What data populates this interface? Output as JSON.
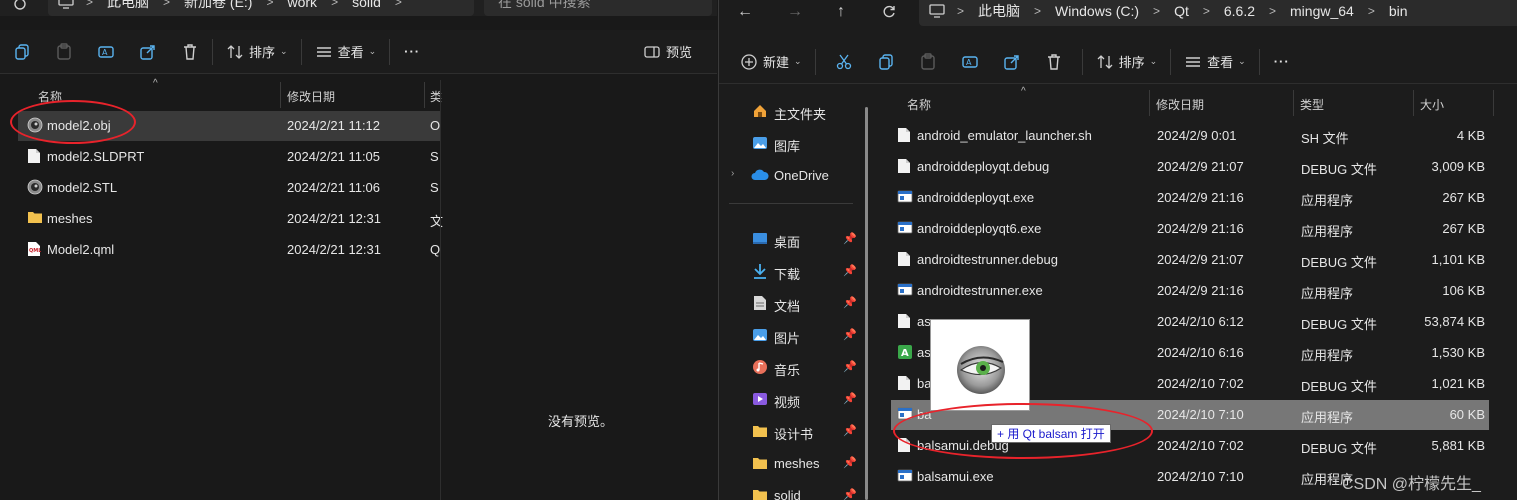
{
  "left_window": {
    "breadcrumb": [
      "此电脑",
      "新加卷 (E:)",
      "work",
      "solid"
    ],
    "search_placeholder": "在 solid 中搜索",
    "toolbar": {
      "sort_label": "排序",
      "view_label": "查看",
      "more_label": "···",
      "preview_label": "预览"
    },
    "columns": {
      "name": "名称",
      "modified": "修改日期",
      "type": "类"
    },
    "files": [
      {
        "name": "model2.obj",
        "modified": "2024/2/21 11:12",
        "type": "O",
        "icon": "obj-file-icon"
      },
      {
        "name": "model2.SLDPRT",
        "modified": "2024/2/21 11:05",
        "type": "S",
        "icon": "file-icon"
      },
      {
        "name": "model2.STL",
        "modified": "2024/2/21 11:06",
        "type": "S",
        "icon": "stl-file-icon"
      },
      {
        "name": "meshes",
        "modified": "2024/2/21 12:31",
        "type": "文",
        "icon": "folder-icon"
      },
      {
        "name": "Model2.qml",
        "modified": "2024/2/21 12:31",
        "type": "Q",
        "icon": "qml-file-icon"
      }
    ],
    "preview_empty": "没有预览。"
  },
  "right_window": {
    "breadcrumb": [
      "此电脑",
      "Windows (C:)",
      "Qt",
      "6.6.2",
      "mingw_64",
      "bin"
    ],
    "toolbar": {
      "new_label": "新建",
      "sort_label": "排序",
      "view_label": "查看",
      "more_label": "···"
    },
    "nav": {
      "home": "主文件夹",
      "gallery": "图库",
      "onedrive": "OneDrive",
      "desktop": "桌面",
      "downloads": "下载",
      "documents": "文档",
      "pictures": "图片",
      "music": "音乐",
      "videos": "视频",
      "design": "设计书",
      "meshes": "meshes",
      "solid": "solid"
    },
    "columns": {
      "name": "名称",
      "modified": "修改日期",
      "type": "类型",
      "size": "大小"
    },
    "files": [
      {
        "name": "android_emulator_launcher.sh",
        "modified": "2024/2/9 0:01",
        "type": "SH 文件",
        "size": "4 KB",
        "icon": "file-icon"
      },
      {
        "name": "androiddeployqt.debug",
        "modified": "2024/2/9 21:07",
        "type": "DEBUG 文件",
        "size": "3,009 KB",
        "icon": "file-icon"
      },
      {
        "name": "androiddeployqt.exe",
        "modified": "2024/2/9 21:16",
        "type": "应用程序",
        "size": "267 KB",
        "icon": "exe-icon"
      },
      {
        "name": "androiddeployqt6.exe",
        "modified": "2024/2/9 21:16",
        "type": "应用程序",
        "size": "267 KB",
        "icon": "exe-icon"
      },
      {
        "name": "androidtestrunner.debug",
        "modified": "2024/2/9 21:07",
        "type": "DEBUG 文件",
        "size": "1,101 KB",
        "icon": "file-icon"
      },
      {
        "name": "androidtestrunner.exe",
        "modified": "2024/2/9 21:16",
        "type": "应用程序",
        "size": "106 KB",
        "icon": "exe-icon"
      },
      {
        "name": "as",
        "modified": "2024/2/10 6:12",
        "type": "DEBUG 文件",
        "size": "53,874 KB",
        "icon": "file-icon"
      },
      {
        "name": "as",
        "modified": "2024/2/10 6:16",
        "type": "应用程序",
        "size": "1,530 KB",
        "icon": "green-app-icon"
      },
      {
        "name": "ba",
        "modified": "2024/2/10 7:02",
        "type": "DEBUG 文件",
        "size": "1,021 KB",
        "icon": "file-icon"
      },
      {
        "name": "ba",
        "modified": "2024/2/10 7:10",
        "type": "应用程序",
        "size": "60 KB",
        "icon": "exe-icon"
      },
      {
        "name": "balsamui.debug",
        "modified": "2024/2/10 7:02",
        "type": "DEBUG 文件",
        "size": "5,881 KB",
        "icon": "file-icon"
      },
      {
        "name": "balsamui.exe",
        "modified": "2024/2/10 7:10",
        "type": "应用程序",
        "size": "",
        "icon": "exe-icon"
      }
    ]
  },
  "drag_tooltip": "+ 用 Qt balsam 打开",
  "watermark": "CSDN @柠檬先生_"
}
